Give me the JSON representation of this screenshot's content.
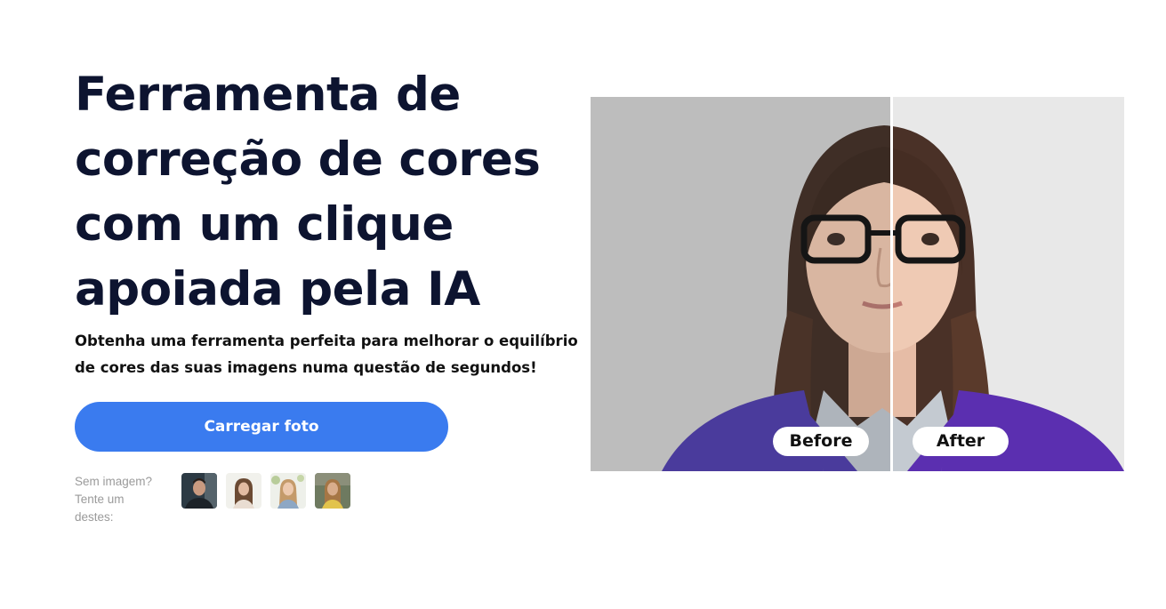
{
  "hero": {
    "title_lines": [
      "Ferramenta de",
      "correção de cores",
      "com um clique",
      "apoiada pela IA"
    ],
    "subtitle_lines": [
      "Obtenha uma ferramenta perfeita para melhorar o equilíbrio",
      "de cores das suas imagens numa questão de segundos!"
    ],
    "upload_label": "Carregar foto"
  },
  "samples": {
    "label_lines": [
      "Sem imagem?",
      "Tente um",
      "destes:"
    ],
    "items": [
      {
        "name": "sample-man"
      },
      {
        "name": "sample-woman-1"
      },
      {
        "name": "sample-woman-2"
      },
      {
        "name": "sample-woman-3"
      }
    ]
  },
  "compare": {
    "before_label": "Before",
    "after_label": "After"
  },
  "colors": {
    "accent": "#3a7bef",
    "title": "#0d1430",
    "muted": "#9a9a9a"
  }
}
